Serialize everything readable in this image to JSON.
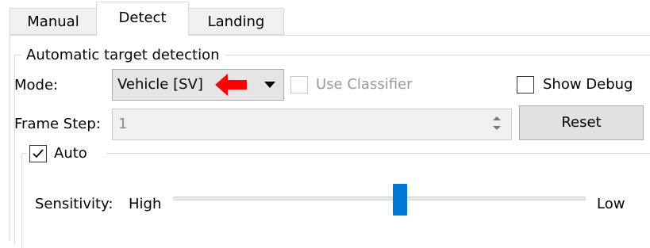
{
  "tabs": [
    {
      "label": "Manual"
    },
    {
      "label": "Detect",
      "active": true
    },
    {
      "label": "Landing"
    }
  ],
  "group": {
    "title": "Automatic target detection",
    "mode": {
      "label": "Mode:",
      "selected": "Vehicle [SV]"
    },
    "use_classifier": {
      "label": "Use Classifier",
      "checked": false,
      "enabled": false
    },
    "show_debug": {
      "label": "Show Debug",
      "checked": false
    },
    "frame_step": {
      "label": "Frame Step:",
      "value": "1",
      "enabled": false
    },
    "reset_label": "Reset",
    "auto": {
      "label": "Auto",
      "checked": true,
      "sensitivity": {
        "label": "Sensitivity:",
        "high_label": "High",
        "low_label": "Low",
        "level": 0.55
      }
    }
  },
  "colors": {
    "accent": "#0078d7",
    "annotation_arrow": "#ff0000"
  }
}
